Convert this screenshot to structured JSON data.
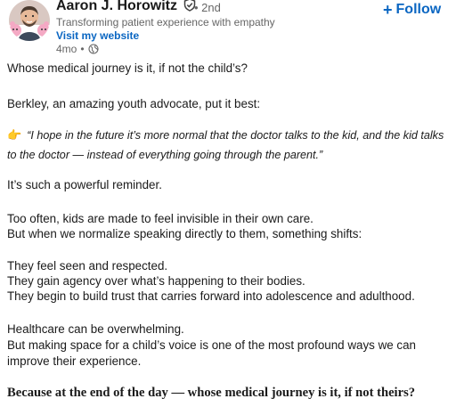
{
  "author": {
    "name": "Aaron J. Horowitz",
    "degree": "• 2nd",
    "headline": "Transforming patient experience with empathy",
    "website_label": "Visit my website",
    "age": "4mo",
    "meta_separator": "•",
    "visibility_icon": "globe-icon",
    "verified_icon": "shield-check-icon"
  },
  "follow": {
    "plus": "+",
    "label": "Follow"
  },
  "post": {
    "p1": "Whose medical journey is it, if not the child’s?",
    "p2": "Berkley, an amazing youth advocate, put it best:",
    "quote_icon": "👉",
    "quote_text": "“I hope in the future it’s more normal that the doctor talks to the kid, and the kid talks to the doctor — instead of everything going through the parent.”",
    "p3": "It’s such a powerful reminder.",
    "p4_line1": "Too often, kids are made to feel invisible in their own care.",
    "p4_line2": "But when we normalize speaking directly to them, something shifts:",
    "p5_line1": "They feel seen and respected.",
    "p5_line2": "They gain agency over what’s happening to their bodies.",
    "p5_line3": "They begin to build trust that carries forward into adolescence and adulthood.",
    "p6_line1": "Healthcare can be overwhelming.",
    "p6_line2": "But making space for a child’s voice is one of the most profound ways we can",
    "p6_line3": "improve their experience.",
    "closing": "Because at the end of the day — whose medical journey is it, if not theirs?"
  },
  "colors": {
    "link_blue": "#0a66c2",
    "muted_gray": "#666666",
    "text": "#1a1a1a"
  }
}
